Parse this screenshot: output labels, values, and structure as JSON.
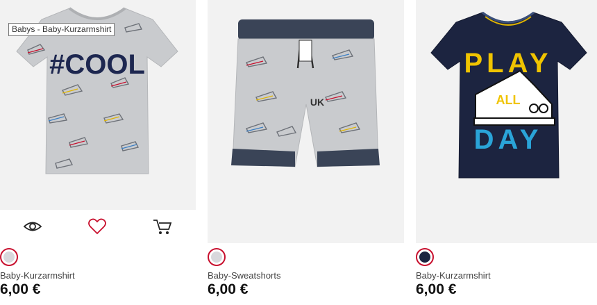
{
  "products": [
    {
      "tooltip": "Babys - Baby-Kurzarmshirt",
      "image_text": "#COOL",
      "swatch_color": "#d8d8dc",
      "name": "Baby-Kurzarmshirt",
      "price": "6,00 €",
      "actions": [
        {
          "icon": "eye-icon"
        },
        {
          "icon": "heart-icon",
          "color": "#c8102e"
        },
        {
          "icon": "cart-icon"
        }
      ]
    },
    {
      "image_text": "UK",
      "swatch_color": "#d8d8dc",
      "name": "Baby-Sweatshorts",
      "price": "6,00 €"
    },
    {
      "image_text_1": "PLAY",
      "image_text_2": "ALL",
      "image_text_3": "DAY",
      "swatch_color": "#1c2440",
      "name": "Baby-Kurzarmshirt",
      "price": "6,00 €"
    }
  ],
  "colors": {
    "accent": "#c8102e",
    "image_bg": "#f2f2f2",
    "navy": "#1c2440",
    "heather_grey": "#c9cbce"
  }
}
